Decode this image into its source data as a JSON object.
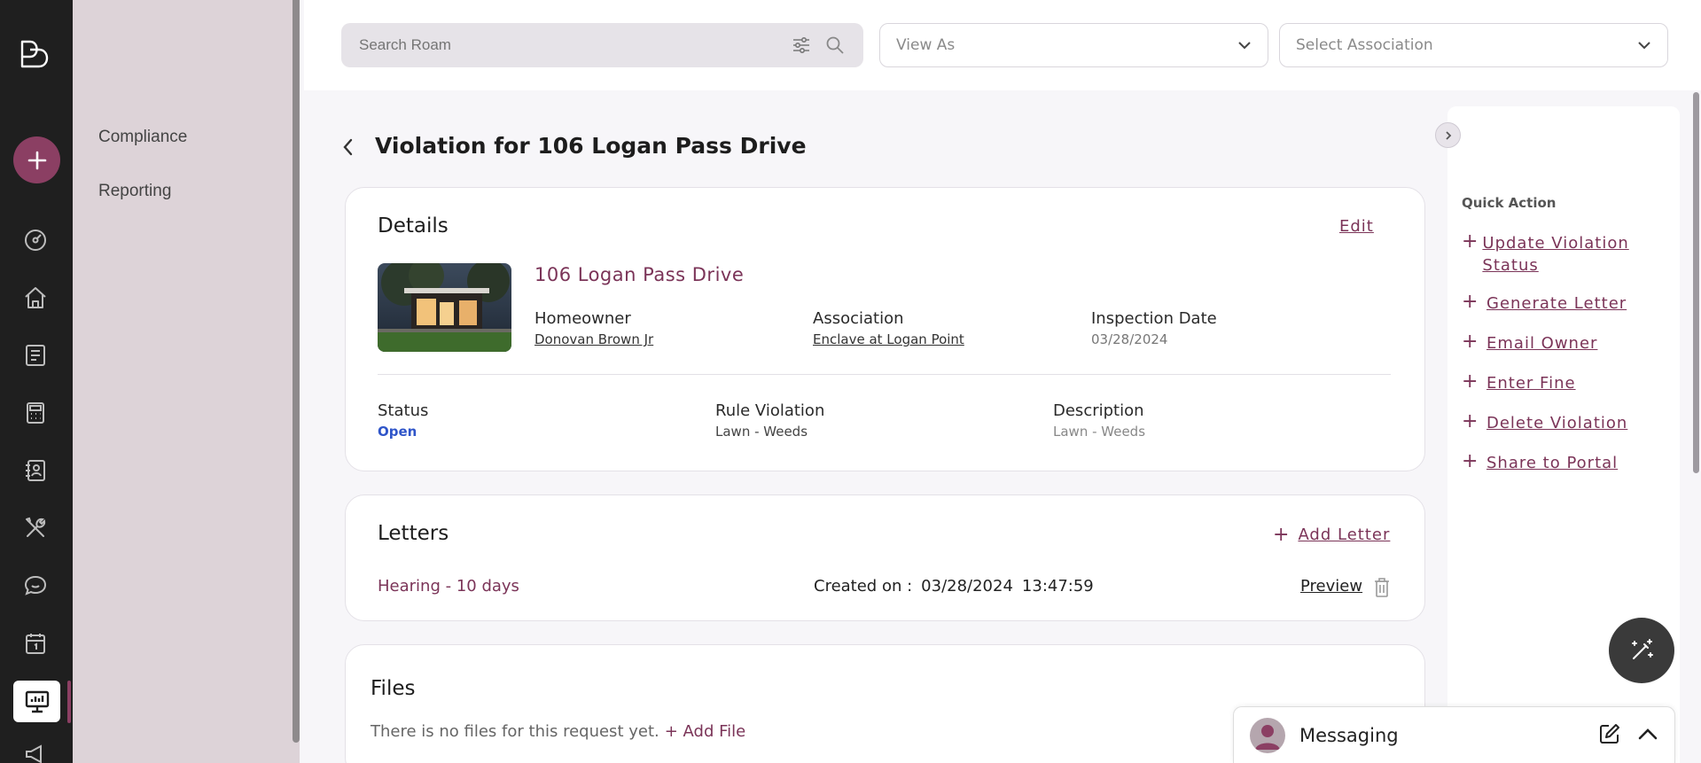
{
  "search": {
    "placeholder": "Search Roam"
  },
  "view_as": {
    "placeholder": "View As"
  },
  "association_select": {
    "placeholder": "Select Association"
  },
  "subnav": {
    "items": [
      {
        "label": "Compliance"
      },
      {
        "label": "Reporting"
      }
    ]
  },
  "page": {
    "title": "Violation for 106 Logan Pass Drive"
  },
  "details": {
    "title": "Details",
    "edit_label": "Edit",
    "property_name": "106 Logan Pass Drive",
    "homeowner_label": "Homeowner",
    "homeowner_value": "Donovan Brown Jr",
    "association_label": "Association",
    "association_value": "Enclave at Logan Point",
    "inspection_label": "Inspection Date",
    "inspection_value": "03/28/2024",
    "status_label": "Status",
    "status_value": "Open",
    "rule_label": "Rule Violation",
    "rule_value": "Lawn - Weeds",
    "description_label": "Description",
    "description_value": "Lawn - Weeds"
  },
  "letters": {
    "title": "Letters",
    "add_label": "Add Letter",
    "rows": [
      {
        "name": "Hearing - 10 days",
        "created_label": "Created on :",
        "date": "03/28/2024",
        "time": "13:47:59",
        "preview_label": "Preview"
      }
    ]
  },
  "files": {
    "title": "Files",
    "empty_text": "There is no files for this request yet.",
    "add_label": "+ Add File"
  },
  "quick_action": {
    "title": "Quick Action",
    "items": [
      {
        "label": "Update Violation Status"
      },
      {
        "label": "Generate Letter"
      },
      {
        "label": "Email Owner"
      },
      {
        "label": "Enter Fine"
      },
      {
        "label": "Delete Violation"
      },
      {
        "label": "Share to Portal"
      }
    ]
  },
  "messaging": {
    "title": "Messaging"
  },
  "colors": {
    "accent": "#7b3458",
    "brand": "#8b3f63",
    "status_open": "#2f55c9",
    "rail": "#1f1f1f",
    "subnav": "#ddd3d8"
  },
  "icons": {
    "rail": [
      "logo-icon",
      "add-icon",
      "dashboard-icon",
      "home-icon",
      "ledger-icon",
      "calculator-icon",
      "contacts-icon",
      "tools-icon",
      "chat-icon",
      "calendar-icon",
      "monitor-icon",
      "megaphone-icon"
    ]
  }
}
